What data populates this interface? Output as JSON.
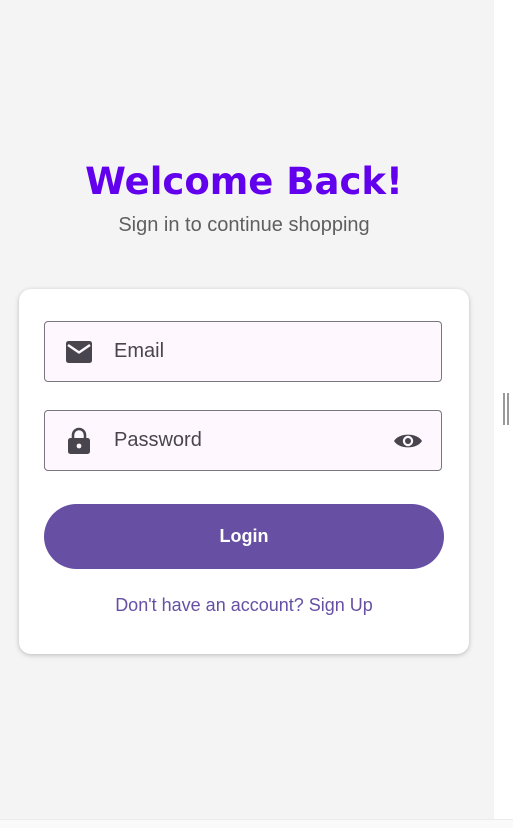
{
  "header": {
    "title": "Welcome Back!",
    "subtitle": "Sign in to continue shopping"
  },
  "form": {
    "email": {
      "placeholder": "Email",
      "value": "",
      "icon": "mail-icon"
    },
    "password": {
      "placeholder": "Password",
      "value": "",
      "icon": "lock-icon",
      "toggle_icon": "eye-icon"
    },
    "login_label": "Login",
    "signup_text": "Don't have an account? Sign Up"
  },
  "colors": {
    "title": "#6200ee",
    "primary_button": "#6750a4",
    "link": "#6750a4",
    "field_background": "#fef8fe",
    "page_background": "#f4f4f4"
  }
}
